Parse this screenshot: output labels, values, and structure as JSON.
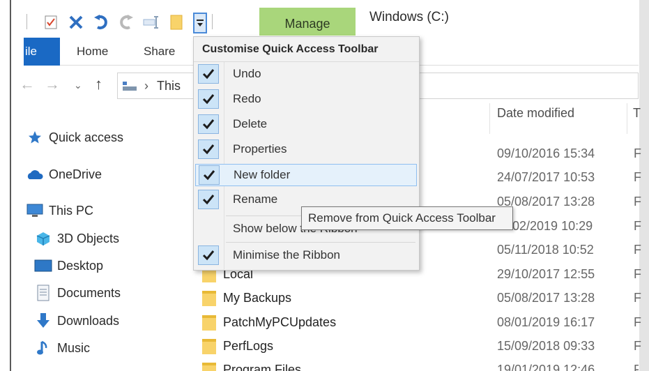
{
  "window": {
    "title": "Windows (C:)",
    "manage_tab": "Manage"
  },
  "ribbon": {
    "file_tab": "ile",
    "tabs": [
      "Home",
      "Share"
    ]
  },
  "qat_icons": [
    "properties-icon",
    "delete-icon",
    "undo-icon",
    "redo-icon",
    "rename-icon",
    "new-folder-icon",
    "customise-dropdown-icon"
  ],
  "address": {
    "path_text": "This"
  },
  "columns": {
    "date_modified": "Date modified",
    "type": "T"
  },
  "sidebar": {
    "items": [
      {
        "label": "Quick access",
        "icon": "star-icon"
      },
      {
        "label": "OneDrive",
        "icon": "cloud-icon"
      },
      {
        "label": "This PC",
        "icon": "computer-icon"
      },
      {
        "label": "3D Objects",
        "icon": "cube-icon"
      },
      {
        "label": "Desktop",
        "icon": "desktop-icon"
      },
      {
        "label": "Documents",
        "icon": "document-icon"
      },
      {
        "label": "Downloads",
        "icon": "download-arrow-icon"
      },
      {
        "label": "Music",
        "icon": "music-note-icon"
      }
    ]
  },
  "files": [
    {
      "name": "",
      "date": "09/10/2016 15:34",
      "type": "F"
    },
    {
      "name": "",
      "date": "24/07/2017 10:53",
      "type": "F"
    },
    {
      "name": "",
      "date": "05/08/2017 13:28",
      "type": "F"
    },
    {
      "name": "",
      "date": "02/2019 10:29",
      "type": "F"
    },
    {
      "name": "",
      "date": "05/11/2018 10:52",
      "type": "F"
    },
    {
      "name": "Local",
      "date": "29/10/2017 12:55",
      "type": "F"
    },
    {
      "name": "My Backups",
      "date": "05/08/2017 13:28",
      "type": "F"
    },
    {
      "name": "PatchMyPCUpdates",
      "date": "08/01/2019 16:17",
      "type": "F"
    },
    {
      "name": "PerfLogs",
      "date": "15/09/2018 09:33",
      "type": "F"
    },
    {
      "name": "Program Files",
      "date": "19/01/2019 12:46",
      "type": "F"
    }
  ],
  "menu": {
    "header": "Customise Quick Access Toolbar",
    "items": [
      {
        "label": "Undo",
        "checked": true
      },
      {
        "label": "Redo",
        "checked": true
      },
      {
        "label": "Delete",
        "checked": true
      },
      {
        "label": "Properties",
        "checked": true
      },
      {
        "label": "New folder",
        "checked": true
      },
      {
        "label": "Rename",
        "checked": true
      },
      {
        "label": "Show below the Ribbon",
        "checked": false
      },
      {
        "label": "Minimise the Ribbon",
        "checked": true
      }
    ]
  },
  "tooltip": {
    "text": "Remove from Quick Access Toolbar"
  },
  "colors": {
    "accent": "#1a69c4",
    "manage": "#a9d67b",
    "folder": "#f8d36a",
    "check_bg": "#cce4f7"
  }
}
